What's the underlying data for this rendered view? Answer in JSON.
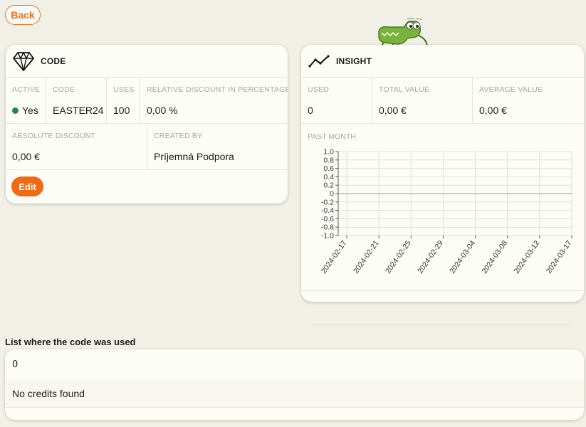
{
  "back_label": "Back",
  "code_card": {
    "title": "CODE",
    "row1": [
      {
        "label": "ACTIVE",
        "value": "Yes"
      },
      {
        "label": "CODE",
        "value": "EASTER24"
      },
      {
        "label": "USES",
        "value": "100"
      },
      {
        "label": "RELATIVE DISCOUNT IN PERCENTAGE",
        "value": "0,00 %"
      }
    ],
    "row2": [
      {
        "label": "ABSOLUTE DISCOUNT",
        "value": "0,00 €"
      },
      {
        "label": "CREATED BY",
        "value": "Príjemná Podpora"
      }
    ],
    "edit_label": "Edit",
    "active_color": "#1f8f3a"
  },
  "insight_card": {
    "title": "INSIGHT",
    "stats": [
      {
        "label": "USED",
        "value": "0"
      },
      {
        "label": "TOTAL VALUE",
        "value": "0,00 €"
      },
      {
        "label": "AVERAGE VALUE",
        "value": "0,00 €"
      }
    ],
    "chart_label": "PAST MONTH"
  },
  "chart_data": {
    "type": "line",
    "x_tick_labels": [
      "2024-02-17",
      "2024-02-21",
      "2024-02-25",
      "2024-02-29",
      "2024-03-04",
      "2024-03-08",
      "2024-03-12",
      "2024-03-17"
    ],
    "y_tick_labels": [
      "1.0",
      "0.8",
      "0.6",
      "0.4",
      "0.2",
      "0",
      "-0.2",
      "-0.4",
      "-0.6",
      "-0.8",
      "-1.0"
    ],
    "ylim": [
      -1.0,
      1.0
    ],
    "series": [
      {
        "values": [
          0,
          0,
          0,
          0,
          0,
          0,
          0,
          0
        ]
      }
    ],
    "grid": true
  },
  "list": {
    "title": "List where the code was used",
    "count": "0",
    "empty_message": "No credits found"
  },
  "accent_color": "#f07020"
}
